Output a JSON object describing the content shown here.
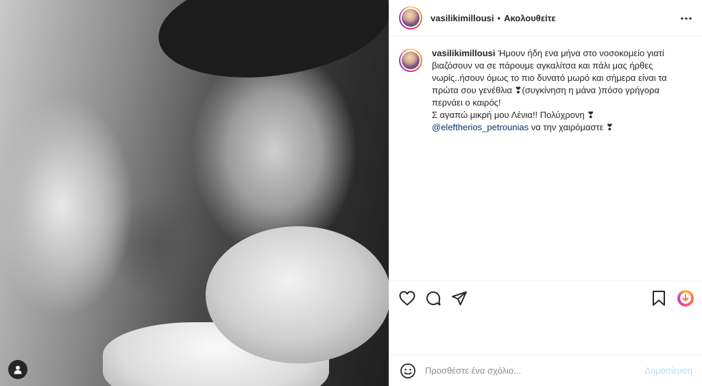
{
  "header": {
    "username": "vasilikimillousi",
    "separator": "•",
    "follow_status": "Ακολουθείτε",
    "more_icon": "more-options-icon"
  },
  "caption": {
    "username": "vasilikimillousi",
    "lines": [
      "Ήμουν ήδη ενα μήνα στο νοσοκομείο γιατί βιαζόσουν να σε πάρουμε αγκαλίτσα και πάλι μας ήρθες νωρίς..ήσουν όμως το πιο δυνατό μωρό και σήμερα είναι τα πρώτα σου γενέθλια ❣(συγκίνηση η μάνα )πόσο γρήγορα περνάει ο καιρός!",
      "Σ αγαπώ μικρή μου Λένια!! Πολύχρονη ❣"
    ],
    "mention": "@eleftherios_petrounias",
    "mention_suffix": " να την χαιρόμαστε ❣"
  },
  "actions": {
    "icons": [
      "heart-icon",
      "comment-icon",
      "share-icon",
      "bookmark-icon",
      "download-icon"
    ]
  },
  "comment_box": {
    "placeholder": "Προσθέστε ένα σχόλιο...",
    "post_label": "Δημοσίευση"
  },
  "colors": {
    "text": "#262626",
    "secondary_text": "#8e8e8e",
    "link": "#00376b",
    "post_disabled": "#b2dffc",
    "border": "#efefef"
  }
}
